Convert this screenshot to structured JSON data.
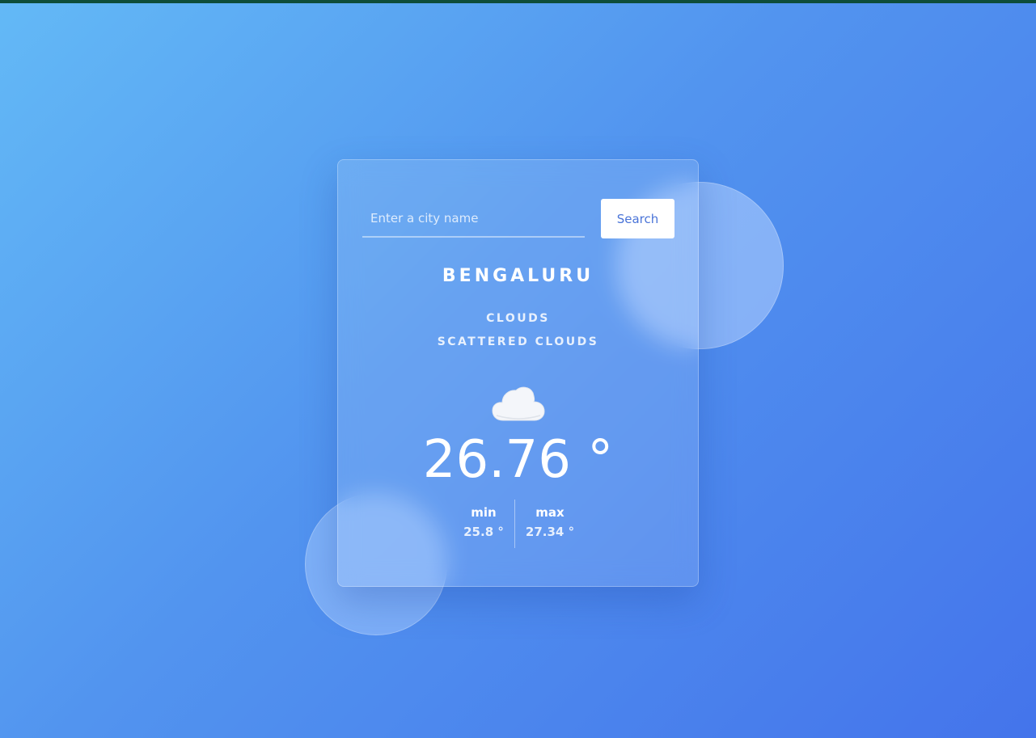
{
  "search": {
    "placeholder": "Enter a city name",
    "value": "",
    "button_label": "Search"
  },
  "weather": {
    "city": "BENGALURU",
    "main": "CLOUDS",
    "description": "SCATTERED CLOUDS",
    "icon": "cloud-icon",
    "temperature": "26.76 °",
    "min_label": "min",
    "min_value": "25.8 °",
    "max_label": "max",
    "max_value": "27.34 °"
  },
  "colors": {
    "background_start": "#63b9f6",
    "background_end": "#4474eb",
    "button_text": "#4a74d8",
    "top_bar": "#0e4d3a"
  }
}
